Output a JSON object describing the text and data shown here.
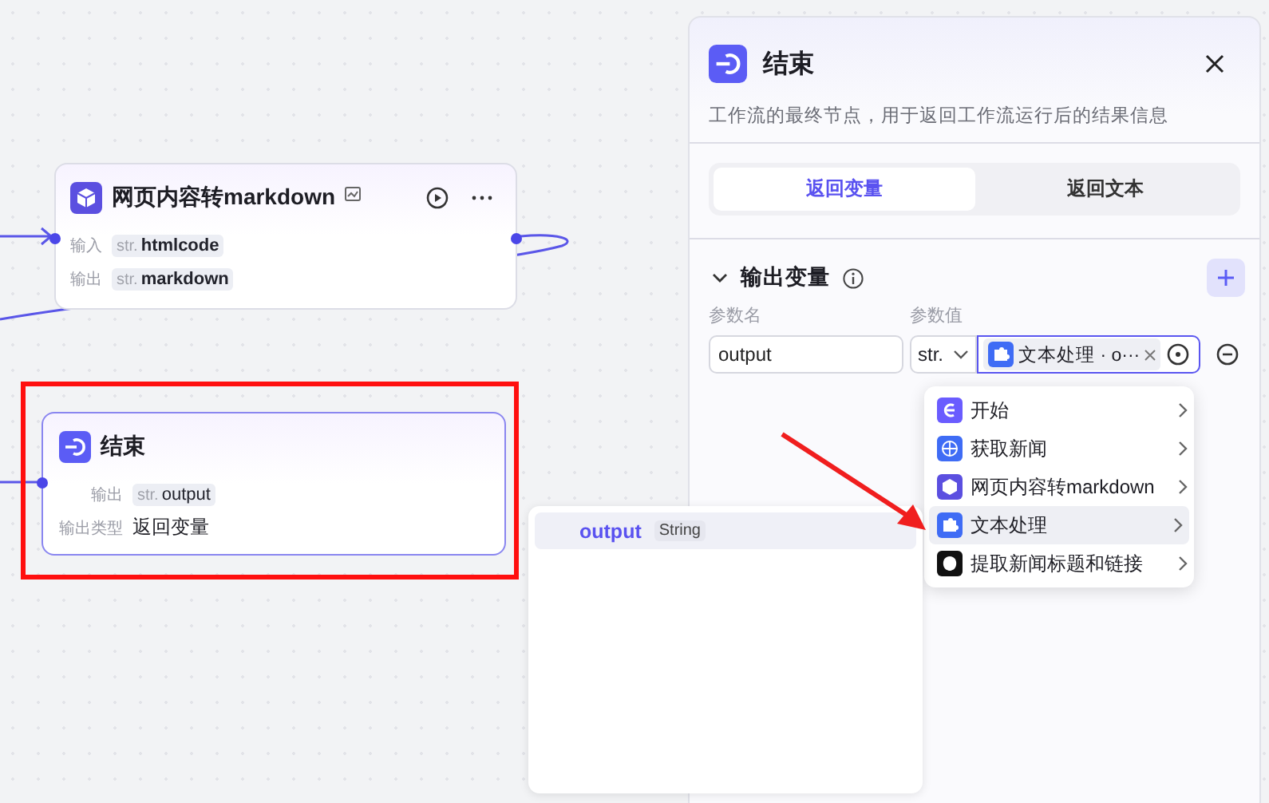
{
  "canvas": {
    "markdown_node": {
      "title": "网页内容转markdown",
      "rows": [
        {
          "label": "输入",
          "type": "str.",
          "value": "htmlcode"
        },
        {
          "label": "输出",
          "type": "str.",
          "value": "markdown"
        }
      ]
    },
    "end_node": {
      "title": "结束",
      "rows": [
        {
          "label": "输出",
          "type": "str.",
          "value": "output"
        }
      ],
      "output_type": {
        "label": "输出类型",
        "value": "返回变量"
      }
    }
  },
  "panel": {
    "title": "结束",
    "description": "工作流的最终节点，用于返回工作流运行后的结果信息",
    "tabs": [
      {
        "label": "返回变量",
        "selected": true
      },
      {
        "label": "返回文本",
        "selected": false
      }
    ],
    "section": {
      "title": "输出变量",
      "expanded": true
    },
    "columns": [
      "参数名",
      "参数值"
    ],
    "variable": {
      "name": "output",
      "type": "str.",
      "reference": "文本处理 · o···"
    }
  },
  "node_menu": [
    {
      "kind": "start",
      "label": "开始",
      "selected": false
    },
    {
      "kind": "http",
      "label": "获取新闻",
      "selected": false
    },
    {
      "kind": "markdown",
      "label": "网页内容转markdown",
      "selected": false
    },
    {
      "kind": "text",
      "label": "文本处理",
      "selected": true
    },
    {
      "kind": "extract",
      "label": "提取新闻标题和链接",
      "selected": false
    }
  ],
  "output_menu": [
    {
      "name": "output",
      "type": "String",
      "selected": true
    }
  ]
}
